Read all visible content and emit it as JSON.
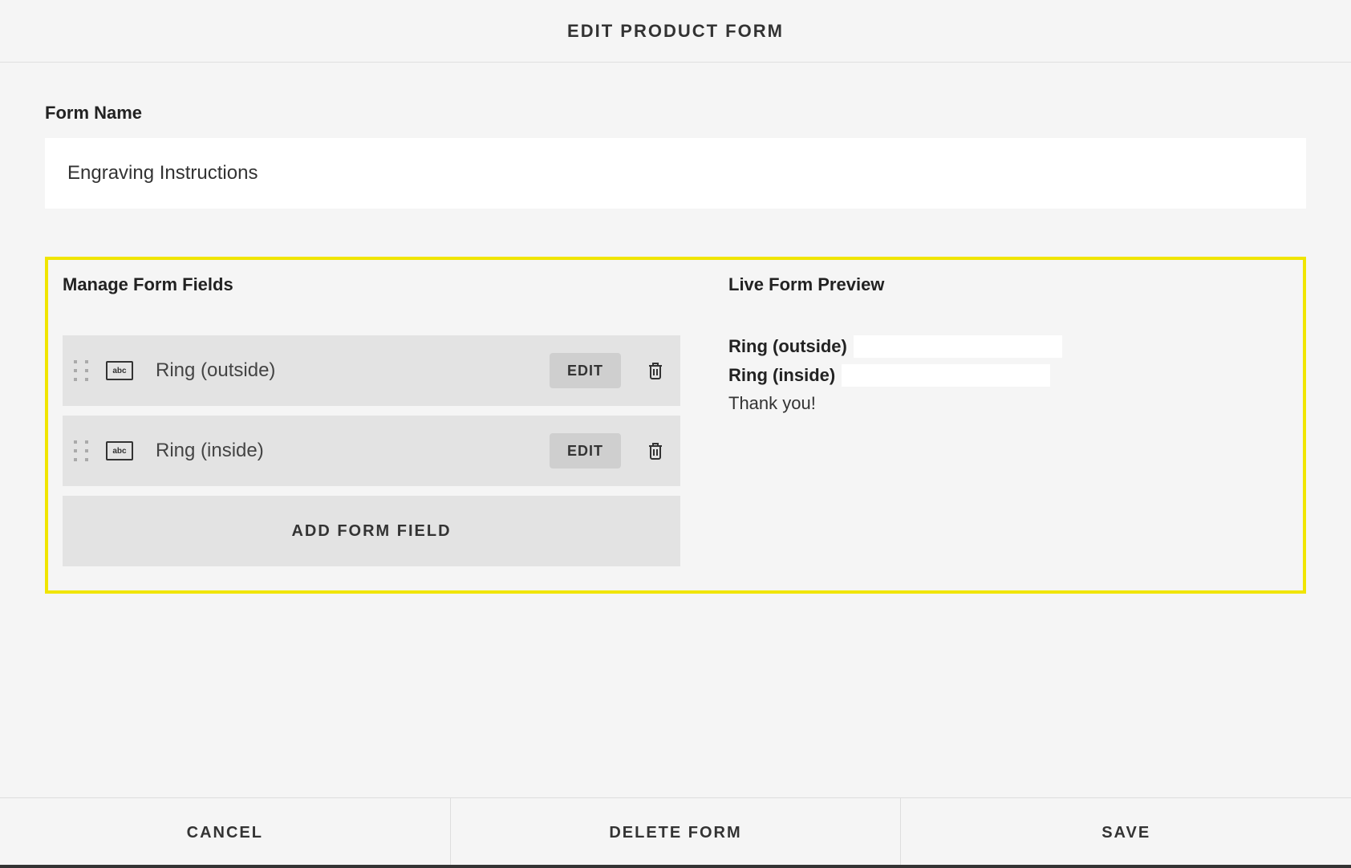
{
  "header": {
    "title": "EDIT PRODUCT FORM"
  },
  "formName": {
    "label": "Form Name",
    "value": "Engraving Instructions"
  },
  "manage": {
    "title": "Manage Form Fields",
    "fields": [
      {
        "label": "Ring (outside)",
        "editLabel": "EDIT",
        "iconText": "abc"
      },
      {
        "label": "Ring (inside)",
        "editLabel": "EDIT",
        "iconText": "abc"
      }
    ],
    "addLabel": "ADD FORM FIELD"
  },
  "preview": {
    "title": "Live Form Preview",
    "rows": [
      {
        "label": "Ring (outside)"
      },
      {
        "label": "Ring (inside)"
      }
    ],
    "thanks": "Thank you!"
  },
  "footer": {
    "cancel": "CANCEL",
    "delete": "DELETE FORM",
    "save": "SAVE"
  }
}
